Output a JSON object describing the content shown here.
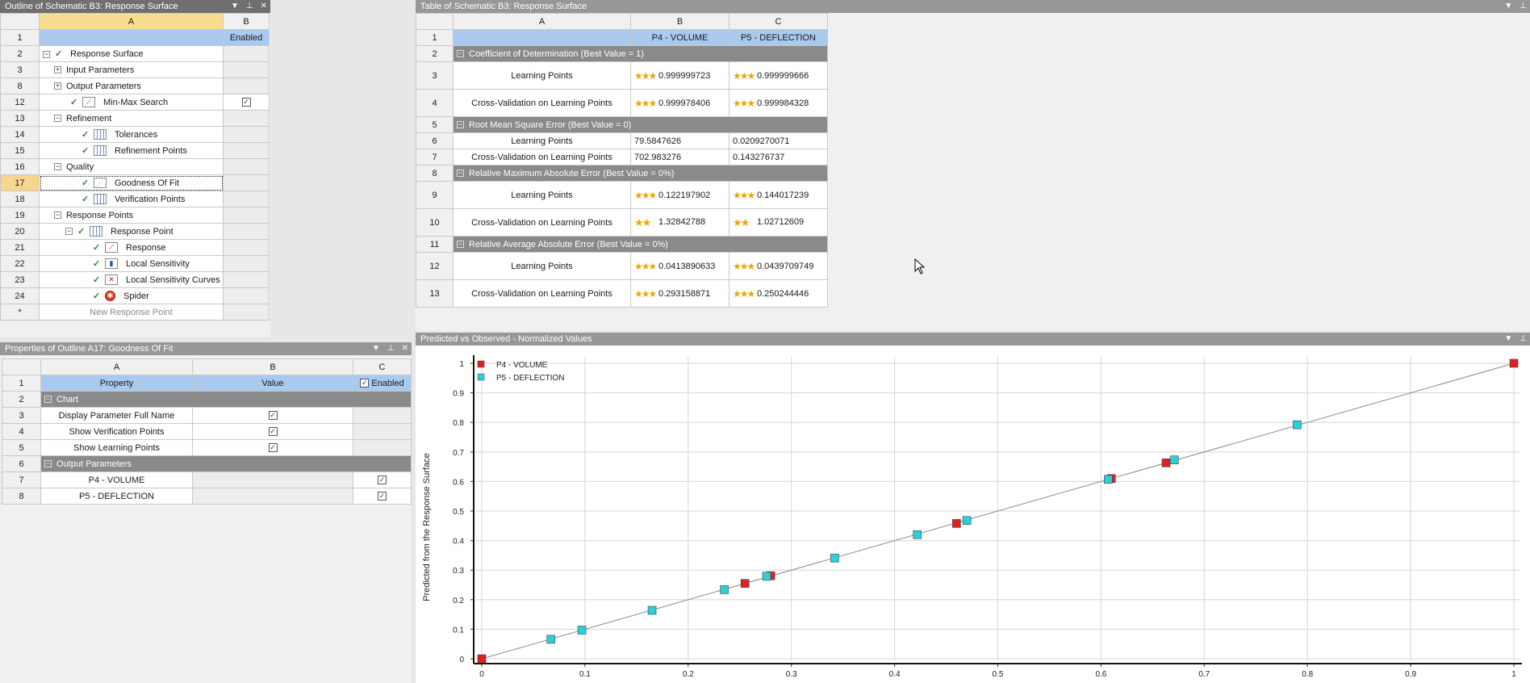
{
  "outline": {
    "title": "Outline of Schematic B3: Response Surface",
    "col_a": "A",
    "col_b": "B",
    "enabled_label": "Enabled",
    "rows": [
      {
        "num": "1",
        "label": "",
        "b": "Enabled",
        "kind": "header"
      },
      {
        "num": "2",
        "label": "Response Surface",
        "kind": "node"
      },
      {
        "num": "3",
        "label": "Input Parameters",
        "kind": "node"
      },
      {
        "num": "8",
        "label": "Output Parameters",
        "kind": "node"
      },
      {
        "num": "12",
        "label": "Min-Max Search",
        "kind": "leaf"
      },
      {
        "num": "13",
        "label": "Refinement",
        "kind": "node"
      },
      {
        "num": "14",
        "label": "Tolerances",
        "kind": "leaf"
      },
      {
        "num": "15",
        "label": "Refinement Points",
        "kind": "leaf"
      },
      {
        "num": "16",
        "label": "Quality",
        "kind": "node"
      },
      {
        "num": "17",
        "label": "Goodness Of Fit",
        "kind": "leaf"
      },
      {
        "num": "18",
        "label": "Verification Points",
        "kind": "leaf"
      },
      {
        "num": "19",
        "label": "Response Points",
        "kind": "node"
      },
      {
        "num": "20",
        "label": "Response Point",
        "kind": "node"
      },
      {
        "num": "21",
        "label": "Response",
        "kind": "leaf"
      },
      {
        "num": "22",
        "label": "Local Sensitivity",
        "kind": "leaf"
      },
      {
        "num": "23",
        "label": "Local Sensitivity Curves",
        "kind": "leaf"
      },
      {
        "num": "24",
        "label": "Spider",
        "kind": "leaf"
      },
      {
        "num": "*",
        "label": "New Response Point",
        "kind": "new"
      }
    ]
  },
  "properties": {
    "title": "Properties of Outline A17: Goodness Of Fit",
    "col_a": "A",
    "col_b": "B",
    "col_c": "C",
    "hdr_property": "Property",
    "hdr_value": "Value",
    "hdr_enabled": "Enabled",
    "rows": [
      {
        "num": "2",
        "label": "Chart"
      },
      {
        "num": "3",
        "label": "Display Parameter Full Name"
      },
      {
        "num": "4",
        "label": "Show Verification Points"
      },
      {
        "num": "5",
        "label": "Show Learning Points"
      },
      {
        "num": "6",
        "label": "Output Parameters"
      },
      {
        "num": "7",
        "label": "P4 - VOLUME"
      },
      {
        "num": "8",
        "label": "P5 - DEFLECTION"
      }
    ]
  },
  "table": {
    "title": "Table of Schematic B3: Response Surface",
    "col_a": "A",
    "col_b": "B",
    "col_c": "C",
    "hdr_b": "P4 - VOLUME",
    "hdr_c": "P5 - DEFLECTION",
    "rows": [
      {
        "num": "2",
        "label": "Coefficient of Determination (Best Value = 1)"
      },
      {
        "num": "3",
        "label": "Learning Points",
        "b": "0.999999723",
        "c": "0.999999666"
      },
      {
        "num": "4",
        "label": "Cross-Validation on Learning Points",
        "b": "0.999978406",
        "c": "0.999984328"
      },
      {
        "num": "5",
        "label": "Root Mean Square Error (Best Value = 0)"
      },
      {
        "num": "6",
        "label": "Learning Points",
        "b": "79.5847626",
        "c": "0.0209270071"
      },
      {
        "num": "7",
        "label": "Cross-Validation on Learning Points",
        "b": "702.983276",
        "c": "0.143276737"
      },
      {
        "num": "8",
        "label": "Relative Maximum Absolute Error (Best Value = 0%)"
      },
      {
        "num": "9",
        "label": "Learning Points",
        "b": "0.122197902",
        "c": "0.144017239"
      },
      {
        "num": "10",
        "label": "Cross-Validation on Learning Points",
        "b": "1.32842788",
        "c": "1.02712609"
      },
      {
        "num": "11",
        "label": "Relative Average Absolute Error (Best Value = 0%)"
      },
      {
        "num": "12",
        "label": "Learning Points",
        "b": "0.0413890633",
        "c": "0.0439709749"
      },
      {
        "num": "13",
        "label": "Cross-Validation on Learning Points",
        "b": "0.293158871",
        "c": "0.250244446"
      }
    ]
  },
  "chart_panel": {
    "title": "Predicted vs Observed - Normalized Values"
  },
  "chart_data": {
    "type": "scatter",
    "title": "",
    "xlabel": "",
    "ylabel": "Predicted from the Response Surface",
    "xlim": [
      0,
      1
    ],
    "ylim": [
      0,
      1
    ],
    "xticks": [
      "0",
      "0.1",
      "0.2",
      "0.3",
      "0.4",
      "0.5",
      "0.6",
      "0.7",
      "0.8",
      "0.9",
      "1"
    ],
    "yticks": [
      "0",
      "0.1",
      "0.2",
      "0.3",
      "0.4",
      "0.5",
      "0.6",
      "0.7",
      "0.8",
      "0.9",
      "1"
    ],
    "grid": true,
    "legend_position": "top-left",
    "reference_line": [
      [
        0,
        0
      ],
      [
        1,
        1
      ]
    ],
    "series": [
      {
        "name": "P4 - VOLUME",
        "color": "#e02020",
        "x": [
          0,
          0.255,
          0.28,
          0.46,
          0.61,
          0.663,
          1
        ],
        "y": [
          0,
          0.255,
          0.281,
          0.458,
          0.61,
          0.663,
          1
        ]
      },
      {
        "name": "P5 - DEFLECTION",
        "color": "#2ecfd6",
        "x": [
          0.067,
          0.097,
          0.165,
          0.235,
          0.276,
          0.342,
          0.422,
          0.47,
          0.607,
          0.671,
          0.79
        ],
        "y": [
          0.066,
          0.097,
          0.164,
          0.234,
          0.279,
          0.341,
          0.42,
          0.468,
          0.607,
          0.673,
          0.792
        ]
      }
    ]
  },
  "colors": {
    "accent_selection": "#f6d58f",
    "header_blue": "#a9c9ef",
    "group_gray": "#8a8a8a",
    "star": "#e8a800"
  }
}
